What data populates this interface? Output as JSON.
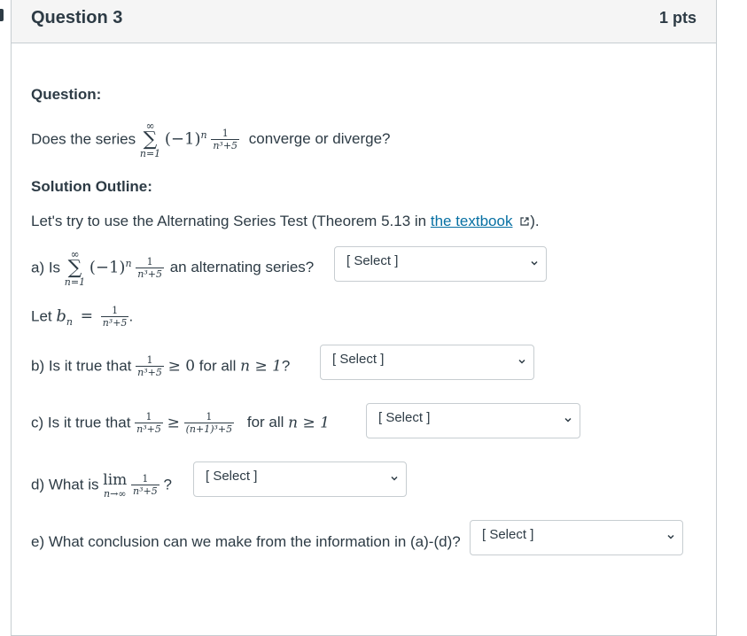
{
  "header": {
    "title": "Question 3",
    "points": "1 pts"
  },
  "question_label": "Question:",
  "prompt": {
    "prefix": "Does the series",
    "suffix": "converge or diverge?"
  },
  "series": {
    "upper": "∞",
    "sigma": "∑",
    "lower": "n=1",
    "term": "(−1)",
    "exp": "n",
    "frac_num": "1",
    "frac_den": "n³+5"
  },
  "solution_label": "Solution Outline:",
  "intro": {
    "text": "Let's try to use the Alternating Series Test (Theorem 5.13 in",
    "link": "the textbook",
    "end": ")."
  },
  "part_a": {
    "prefix": "a) Is",
    "suffix": "an alternating series?"
  },
  "let_bn": {
    "prefix": "Let",
    "var": "b",
    "sub": "n",
    "eq": "=",
    "num": "1",
    "den": "n³+5",
    "dot": "."
  },
  "part_b": {
    "prefix": "b) Is it true that",
    "num": "1",
    "den": "n³+5",
    "rel": "≥ 0",
    "for_all": "for all",
    "cond": "n ≥ 1",
    "q": "?"
  },
  "part_c": {
    "prefix": "c) Is it true that",
    "num1": "1",
    "den1": "n³+5",
    "rel": "≥",
    "num2": "1",
    "den2": "(n+1)³+5",
    "for_all": "for all",
    "cond": "n ≥ 1"
  },
  "part_d": {
    "prefix": "d) What is",
    "lim": "lim",
    "lim_sub": "n→∞",
    "num": "1",
    "den": "n³+5",
    "q": "?"
  },
  "part_e": {
    "text": "e) What conclusion can we make from the information in (a)-(d)?"
  },
  "select_placeholder": "[ Select ]",
  "colors": {
    "link": "#0770a3",
    "text": "#2d3b45",
    "border": "#c7cdd1",
    "header_bg": "#f5f5f5"
  }
}
